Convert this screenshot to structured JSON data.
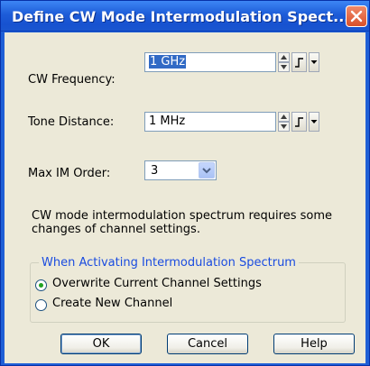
{
  "window": {
    "title": "Define CW Mode Intermodulation Spect..."
  },
  "fields": {
    "cw_frequency": {
      "label": "CW Frequency:",
      "value": "1 GHz"
    },
    "tone_distance": {
      "label": "Tone Distance:",
      "value": "1 MHz"
    },
    "max_im_order": {
      "label": "Max IM Order:",
      "value": "3"
    }
  },
  "note": "CW mode intermodulation spectrum requires some changes of channel settings.",
  "group": {
    "title": "When Activating Intermodulation Spectrum",
    "options": [
      {
        "label": "Overwrite Current Channel Settings",
        "checked": true
      },
      {
        "label": "Create New Channel",
        "checked": false
      }
    ]
  },
  "buttons": {
    "ok": "OK",
    "cancel": "Cancel",
    "help": "Help"
  },
  "colors": {
    "title_bar": "#1d5cd8",
    "dialog_bg": "#ece9d8",
    "group_title": "#1a4ce0",
    "close_button": "#d9502a",
    "selection": "#316ac5"
  }
}
